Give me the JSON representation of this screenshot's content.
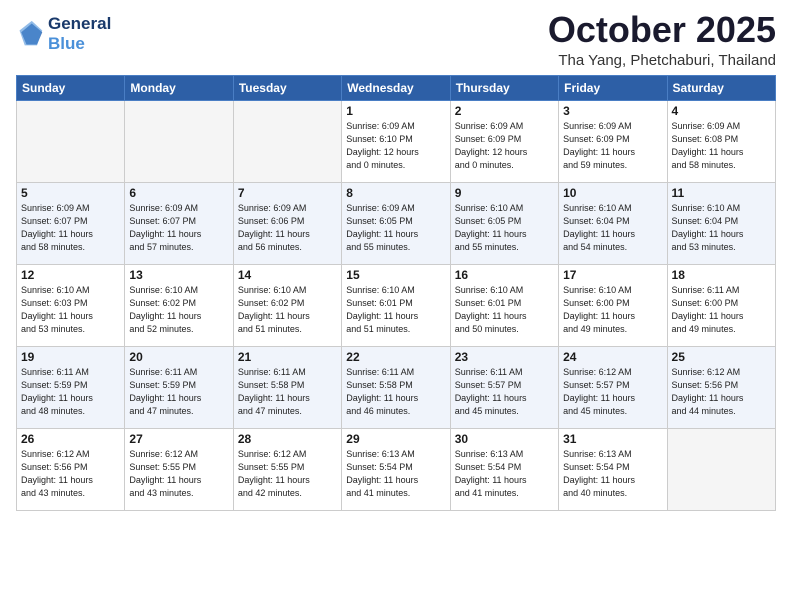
{
  "header": {
    "logo_line1": "General",
    "logo_line2": "Blue",
    "month": "October 2025",
    "location": "Tha Yang, Phetchaburi, Thailand"
  },
  "weekdays": [
    "Sunday",
    "Monday",
    "Tuesday",
    "Wednesday",
    "Thursday",
    "Friday",
    "Saturday"
  ],
  "weeks": [
    [
      {
        "day": "",
        "info": ""
      },
      {
        "day": "",
        "info": ""
      },
      {
        "day": "",
        "info": ""
      },
      {
        "day": "1",
        "info": "Sunrise: 6:09 AM\nSunset: 6:10 PM\nDaylight: 12 hours\nand 0 minutes."
      },
      {
        "day": "2",
        "info": "Sunrise: 6:09 AM\nSunset: 6:09 PM\nDaylight: 12 hours\nand 0 minutes."
      },
      {
        "day": "3",
        "info": "Sunrise: 6:09 AM\nSunset: 6:09 PM\nDaylight: 11 hours\nand 59 minutes."
      },
      {
        "day": "4",
        "info": "Sunrise: 6:09 AM\nSunset: 6:08 PM\nDaylight: 11 hours\nand 58 minutes."
      }
    ],
    [
      {
        "day": "5",
        "info": "Sunrise: 6:09 AM\nSunset: 6:07 PM\nDaylight: 11 hours\nand 58 minutes."
      },
      {
        "day": "6",
        "info": "Sunrise: 6:09 AM\nSunset: 6:07 PM\nDaylight: 11 hours\nand 57 minutes."
      },
      {
        "day": "7",
        "info": "Sunrise: 6:09 AM\nSunset: 6:06 PM\nDaylight: 11 hours\nand 56 minutes."
      },
      {
        "day": "8",
        "info": "Sunrise: 6:09 AM\nSunset: 6:05 PM\nDaylight: 11 hours\nand 55 minutes."
      },
      {
        "day": "9",
        "info": "Sunrise: 6:10 AM\nSunset: 6:05 PM\nDaylight: 11 hours\nand 55 minutes."
      },
      {
        "day": "10",
        "info": "Sunrise: 6:10 AM\nSunset: 6:04 PM\nDaylight: 11 hours\nand 54 minutes."
      },
      {
        "day": "11",
        "info": "Sunrise: 6:10 AM\nSunset: 6:04 PM\nDaylight: 11 hours\nand 53 minutes."
      }
    ],
    [
      {
        "day": "12",
        "info": "Sunrise: 6:10 AM\nSunset: 6:03 PM\nDaylight: 11 hours\nand 53 minutes."
      },
      {
        "day": "13",
        "info": "Sunrise: 6:10 AM\nSunset: 6:02 PM\nDaylight: 11 hours\nand 52 minutes."
      },
      {
        "day": "14",
        "info": "Sunrise: 6:10 AM\nSunset: 6:02 PM\nDaylight: 11 hours\nand 51 minutes."
      },
      {
        "day": "15",
        "info": "Sunrise: 6:10 AM\nSunset: 6:01 PM\nDaylight: 11 hours\nand 51 minutes."
      },
      {
        "day": "16",
        "info": "Sunrise: 6:10 AM\nSunset: 6:01 PM\nDaylight: 11 hours\nand 50 minutes."
      },
      {
        "day": "17",
        "info": "Sunrise: 6:10 AM\nSunset: 6:00 PM\nDaylight: 11 hours\nand 49 minutes."
      },
      {
        "day": "18",
        "info": "Sunrise: 6:11 AM\nSunset: 6:00 PM\nDaylight: 11 hours\nand 49 minutes."
      }
    ],
    [
      {
        "day": "19",
        "info": "Sunrise: 6:11 AM\nSunset: 5:59 PM\nDaylight: 11 hours\nand 48 minutes."
      },
      {
        "day": "20",
        "info": "Sunrise: 6:11 AM\nSunset: 5:59 PM\nDaylight: 11 hours\nand 47 minutes."
      },
      {
        "day": "21",
        "info": "Sunrise: 6:11 AM\nSunset: 5:58 PM\nDaylight: 11 hours\nand 47 minutes."
      },
      {
        "day": "22",
        "info": "Sunrise: 6:11 AM\nSunset: 5:58 PM\nDaylight: 11 hours\nand 46 minutes."
      },
      {
        "day": "23",
        "info": "Sunrise: 6:11 AM\nSunset: 5:57 PM\nDaylight: 11 hours\nand 45 minutes."
      },
      {
        "day": "24",
        "info": "Sunrise: 6:12 AM\nSunset: 5:57 PM\nDaylight: 11 hours\nand 45 minutes."
      },
      {
        "day": "25",
        "info": "Sunrise: 6:12 AM\nSunset: 5:56 PM\nDaylight: 11 hours\nand 44 minutes."
      }
    ],
    [
      {
        "day": "26",
        "info": "Sunrise: 6:12 AM\nSunset: 5:56 PM\nDaylight: 11 hours\nand 43 minutes."
      },
      {
        "day": "27",
        "info": "Sunrise: 6:12 AM\nSunset: 5:55 PM\nDaylight: 11 hours\nand 43 minutes."
      },
      {
        "day": "28",
        "info": "Sunrise: 6:12 AM\nSunset: 5:55 PM\nDaylight: 11 hours\nand 42 minutes."
      },
      {
        "day": "29",
        "info": "Sunrise: 6:13 AM\nSunset: 5:54 PM\nDaylight: 11 hours\nand 41 minutes."
      },
      {
        "day": "30",
        "info": "Sunrise: 6:13 AM\nSunset: 5:54 PM\nDaylight: 11 hours\nand 41 minutes."
      },
      {
        "day": "31",
        "info": "Sunrise: 6:13 AM\nSunset: 5:54 PM\nDaylight: 11 hours\nand 40 minutes."
      },
      {
        "day": "",
        "info": ""
      }
    ]
  ]
}
